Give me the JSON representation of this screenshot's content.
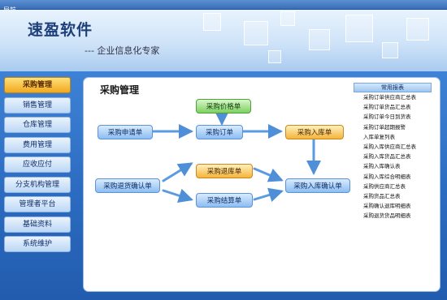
{
  "window": {
    "title": "导航"
  },
  "banner": {
    "brand": "速盈软件",
    "slogan": "--- 企业信息化专家"
  },
  "sidebar": {
    "items": [
      {
        "label": "采购管理",
        "active": true
      },
      {
        "label": "销售管理"
      },
      {
        "label": "仓库管理"
      },
      {
        "label": "费用管理"
      },
      {
        "label": "应收应付"
      },
      {
        "label": "分支机构管理"
      },
      {
        "label": "管理者平台"
      },
      {
        "label": "基础资料"
      },
      {
        "label": "系统维护"
      }
    ]
  },
  "panel": {
    "title": "采购管理",
    "nodes": {
      "price": "采购价格单",
      "request": "采购申请单",
      "order": "采购订单",
      "inbound": "采购入库单",
      "return_confirm": "采购退货确认单",
      "return": "采购退库单",
      "settlement": "采购结算单",
      "inbound_confirm": "采购入库确认单"
    }
  },
  "reports": {
    "header": "常用报表",
    "items": [
      "采购订单供应商汇总表",
      "采购订单货品汇总表",
      "采购订单今日到货表",
      "采购订单超期报警",
      "入库单复列表",
      "采购入库供应商汇总表",
      "采购入库货品汇总表",
      "采购入库确认表",
      "采购入库综合明细表",
      "采购供应商汇总表",
      "采购货品汇总表",
      "采购确认退库明细表",
      "采购退货货品明细表"
    ]
  },
  "colors": {
    "accent": "#f0a81f",
    "sidebar_bg": "#bcd7f5",
    "background": "#2a69bd"
  }
}
